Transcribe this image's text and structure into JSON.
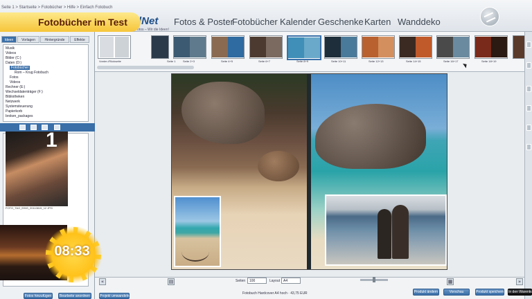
{
  "banner": {
    "title": "Fotobücher im Test"
  },
  "header": {
    "breadcrumbs": "Seite 1 > Startseite > Fotobücher > Hilfe > Einfach Fotobuch",
    "logo": "lNet",
    "logo_tagline": "Sie haben die Fotos – Wir die Ideen!",
    "nav": [
      "Fotos & Poster",
      "Fotobücher",
      "Kalender",
      "Geschenke",
      "Karten",
      "Wanddeko"
    ]
  },
  "left_panel": {
    "tabs": [
      "Ideen",
      "Vorlagen",
      "Hintergründe",
      "Effekte"
    ],
    "tree": [
      "Musik",
      "Videos",
      "Bilder (C:)",
      "Daten (D:)",
      "Fotobücher",
      "Rom – Krug Fotobuch",
      "Fotos",
      "Videos",
      "Rechner (E:)",
      "Wechseldatenträger (F:)",
      "Bibliotheken",
      "Netzwerk",
      "Systemsteuerung",
      "Papierkorb",
      "broken_packages"
    ],
    "photo_number": "1",
    "photo_caption": "FOTO_TAG_EINS_20110815_12 JPG",
    "add_button": "Fotos hinzufügen",
    "arrange_button": "Bearbeite anordnen"
  },
  "page_strip": {
    "labels": [
      "Vorder-/Rückseite",
      "Seite 1",
      "Seite 2+3",
      "Seite 4+5",
      "Seite 6+7",
      "Seite 8+9",
      "Seite 10+11",
      "Seite 12+13",
      "Seite 14+15",
      "Seite 16+17",
      "Seite 18+19"
    ]
  },
  "bottom_bar": {
    "pages_label": "Seiten",
    "pages_value": "100",
    "layout_label": "Layout",
    "layout_value": "A4",
    "convert_button": "Projekt umwandeln",
    "product_info": "Fotobuch Hardcover A4 hoch · 43,75 EUR",
    "change_button": "Produkt ändern",
    "preview_button": "Vorschau",
    "cart_button": "Produkt speichern",
    "basket_button": "In den Warenkorb"
  },
  "overlay": {
    "clock": "08:33"
  },
  "colors": {
    "accent": "#3a6fa8",
    "banner": "#f6c53a",
    "banner_text": "#5a1e06"
  }
}
